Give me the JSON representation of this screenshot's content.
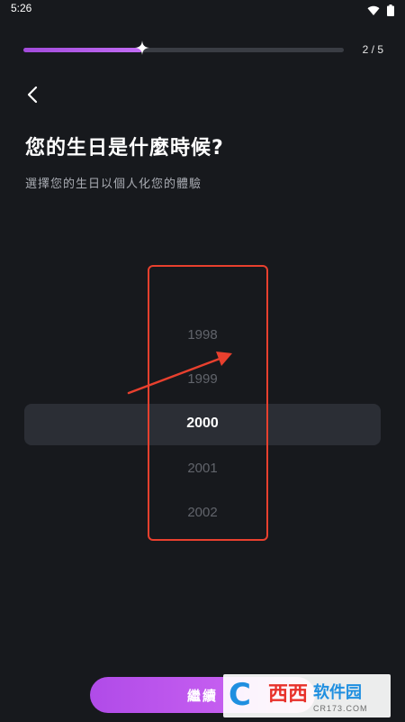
{
  "status_bar": {
    "time": "5:26",
    "icons": [
      "wifi-icon",
      "battery-icon"
    ]
  },
  "progress": {
    "label": "2 / 5",
    "fraction": 0.37
  },
  "header": {
    "back_icon": "chevron-left-icon"
  },
  "main": {
    "title": "您的生日是什麼時候?",
    "subtitle": "選擇您的生日以個人化您的體驗"
  },
  "year_picker": {
    "items": [
      "1998",
      "1999",
      "2000",
      "2001",
      "2002"
    ],
    "selected": "2000"
  },
  "footer": {
    "continue_label": "繼續"
  },
  "watermark": {
    "logo_letter": "C",
    "xixi": "西西",
    "brand": "软件园",
    "url": "CR173.COM"
  },
  "colors": {
    "background": "#17191d",
    "accent": "#b04be8",
    "annotation": "#e8402e",
    "muted_text": "#61646b"
  }
}
